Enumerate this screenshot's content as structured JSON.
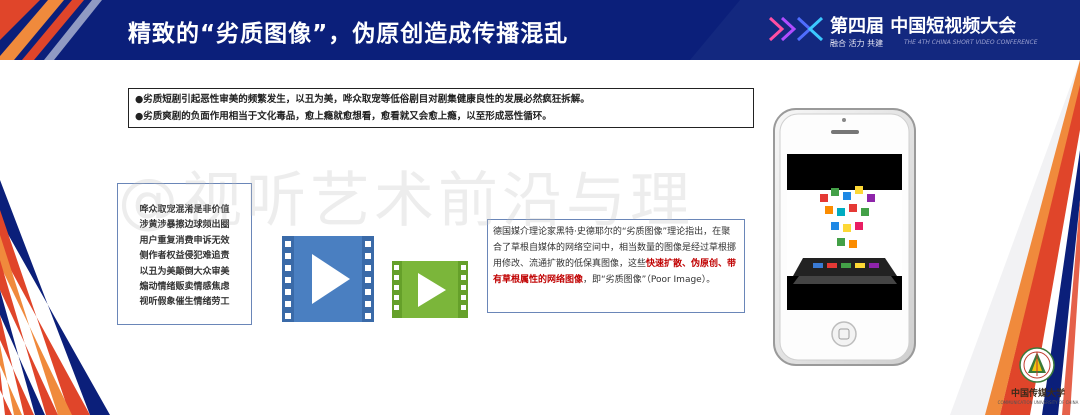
{
  "header": {
    "title": "精致的“劣质图像”，伪原创造成传播混乱"
  },
  "brand": {
    "name": "第四届 中国短视频大会",
    "slogan": "融合 活力 共建",
    "english": "THE 4TH CHINA SHORT VIDEO CONFERENCE"
  },
  "bullets": [
    "●劣质短剧引起恶性审美的频繁发生，以丑为美，哗众取宠等低俗剧目对剧集健康良性的发展必然疯狂拆解。",
    "●劣质爽剧的负面作用相当于文化毒品，愈上瘾就愈想看，愈看就又会愈上瘾，以至形成恶性循环。"
  ],
  "quote_lines": [
    "哗众取宠混淆是非价值",
    "涉黄涉暴擦边球频出圈",
    "用户重复消费申诉无效",
    "侧作者权益侵犯难追责",
    "以丑为美颠倒大众审美",
    "煽动情绪贩卖情感焦虑",
    "视听假象催生情绪劳工"
  ],
  "theory": {
    "part1": "德国媒介理论家黑特·史德耶尔的“劣质图像”理论指出，在聚合了草根自媒体的网络空间中，相当数量的图像是经过草根挪用修改、流通扩散的低保真图像，这些",
    "highlight": "快速扩散、伪原创、带有草根属性的网络图像",
    "part2": "，即“劣质图像”（Poor Image）。"
  },
  "watermark": "@视听艺术前沿与理",
  "logo": {
    "name": "中国传媒大学",
    "english": "COMMUNICATION UNIVERSITY OF CHINA"
  },
  "colors": {
    "header_bg": "#0b1f7a",
    "accent_red": "#e0452a",
    "accent_orange": "#f08a3c",
    "video_blue": "#4a7fc1",
    "video_green": "#7bb63a",
    "highlight_red": "#c00000"
  },
  "icons": [
    "play-video-icon-blue",
    "play-video-icon-green",
    "smartphone-icon",
    "university-seal-icon",
    "brand-logo-icon"
  ]
}
